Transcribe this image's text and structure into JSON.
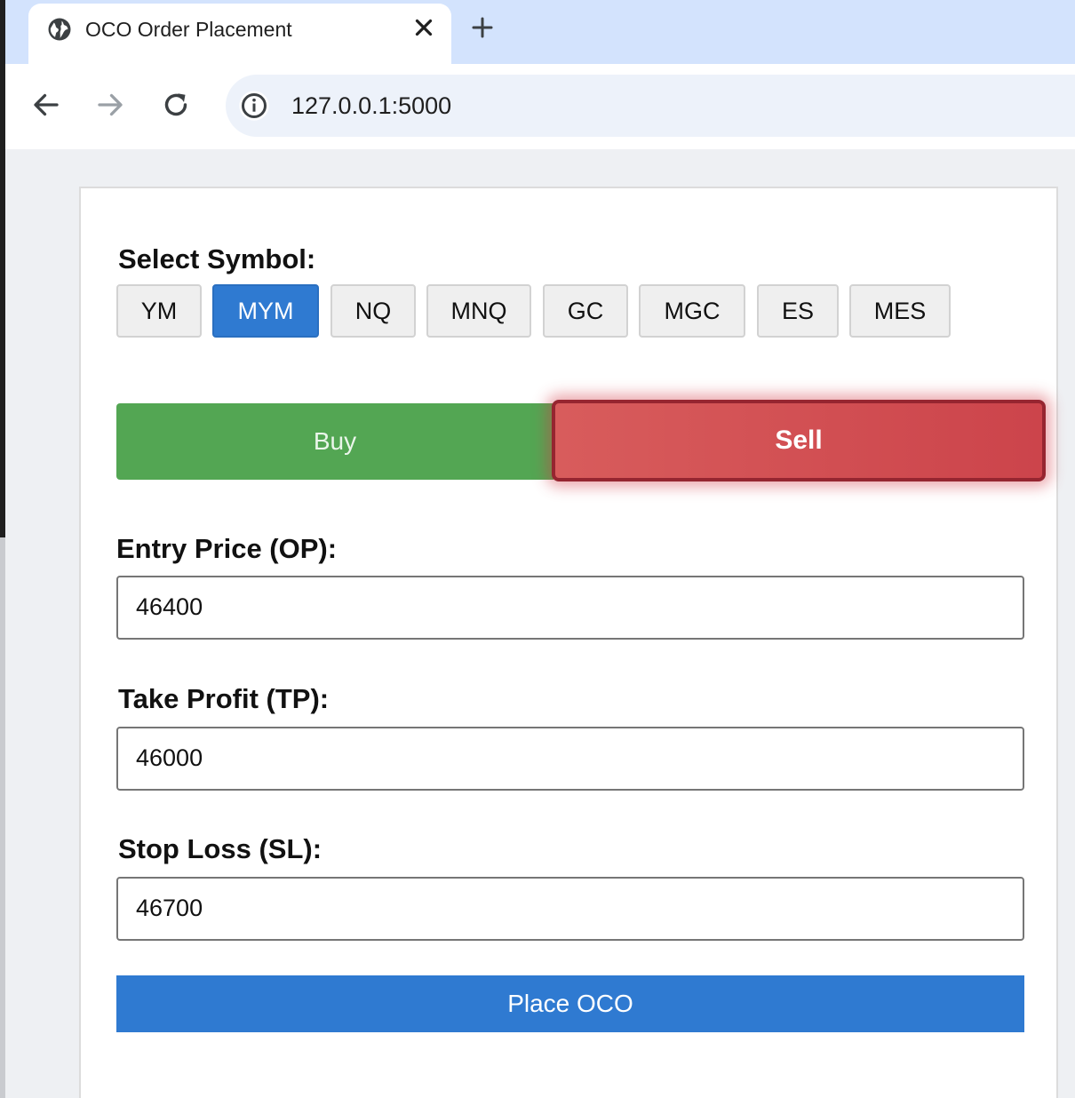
{
  "browser": {
    "tab_title": "OCO Order Placement",
    "url": "127.0.0.1:5000"
  },
  "form": {
    "symbol_label": "Select Symbol:",
    "symbols": [
      "YM",
      "MYM",
      "NQ",
      "MNQ",
      "GC",
      "MGC",
      "ES",
      "MES"
    ],
    "selected_symbol": "MYM",
    "side_buy_label": "Buy",
    "side_sell_label": "Sell",
    "selected_side": "Sell",
    "entry_label": "Entry Price (OP):",
    "entry_value": "46400",
    "tp_label": "Take Profit (TP):",
    "tp_value": "46000",
    "sl_label": "Stop Loss (SL):",
    "sl_value": "46700",
    "submit_label": "Place OCO"
  },
  "colors": {
    "accent_blue": "#2f7ad1",
    "buy_green": "#53a653",
    "sell_red": "#d2464c",
    "tab_strip": "#d3e3fd"
  },
  "icons": {
    "tab_favicon": "globe-icon",
    "tab_close": "close-icon",
    "new_tab": "plus-icon",
    "back": "arrow-left-icon",
    "forward": "arrow-right-icon",
    "reload": "reload-icon",
    "site_info": "info-icon"
  }
}
